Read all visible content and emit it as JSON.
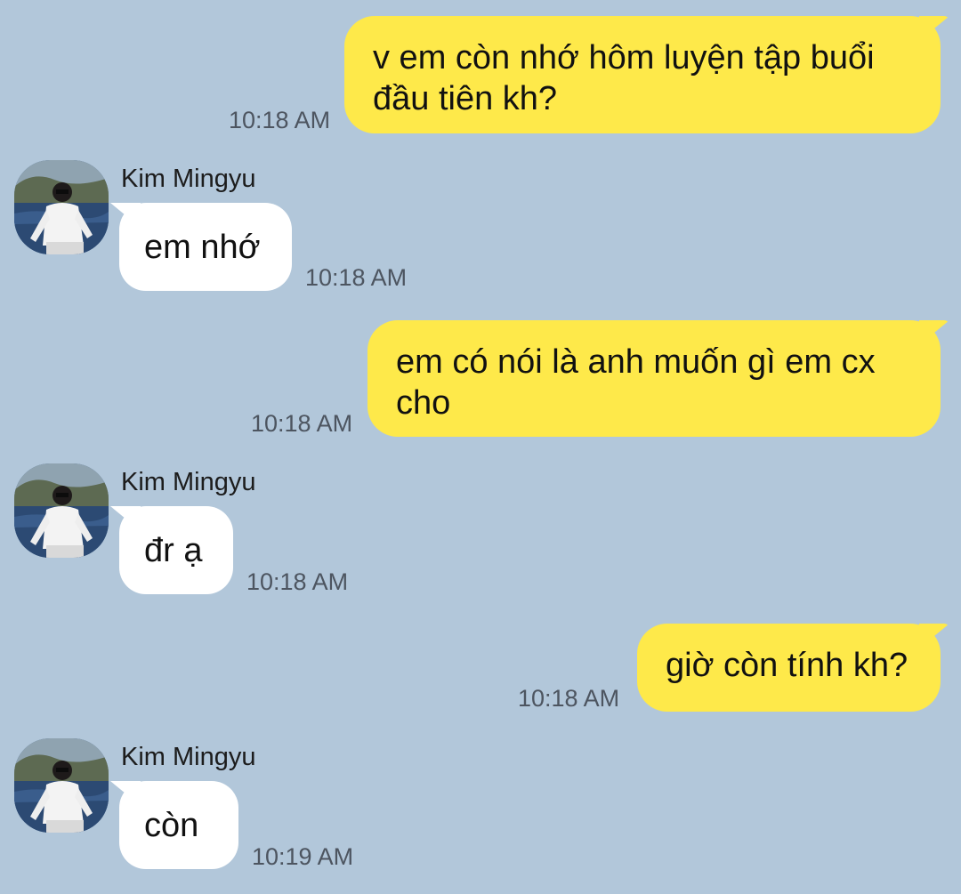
{
  "colors": {
    "background": "#b2c7da",
    "outgoing_bubble": "#fee94a",
    "incoming_bubble": "#ffffff",
    "timestamp_text": "#4d5560"
  },
  "messages": [
    {
      "direction": "outgoing",
      "text": "v em còn nhớ hôm luyện tập buổi đầu tiên kh?",
      "time": "10:18 AM"
    },
    {
      "direction": "incoming",
      "sender": "Kim Mingyu",
      "avatar": "user-photo",
      "text": "em nhớ",
      "time": "10:18 AM"
    },
    {
      "direction": "outgoing",
      "text": "em có nói là anh muốn gì em cx cho",
      "time": "10:18 AM"
    },
    {
      "direction": "incoming",
      "sender": "Kim Mingyu",
      "avatar": "user-photo",
      "text": "đr ạ",
      "time": "10:18 AM"
    },
    {
      "direction": "outgoing",
      "text": "giờ còn tính kh?",
      "time": "10:18 AM"
    },
    {
      "direction": "incoming",
      "sender": "Kim Mingyu",
      "avatar": "user-photo",
      "text": "còn",
      "time": "10:19 AM"
    }
  ]
}
